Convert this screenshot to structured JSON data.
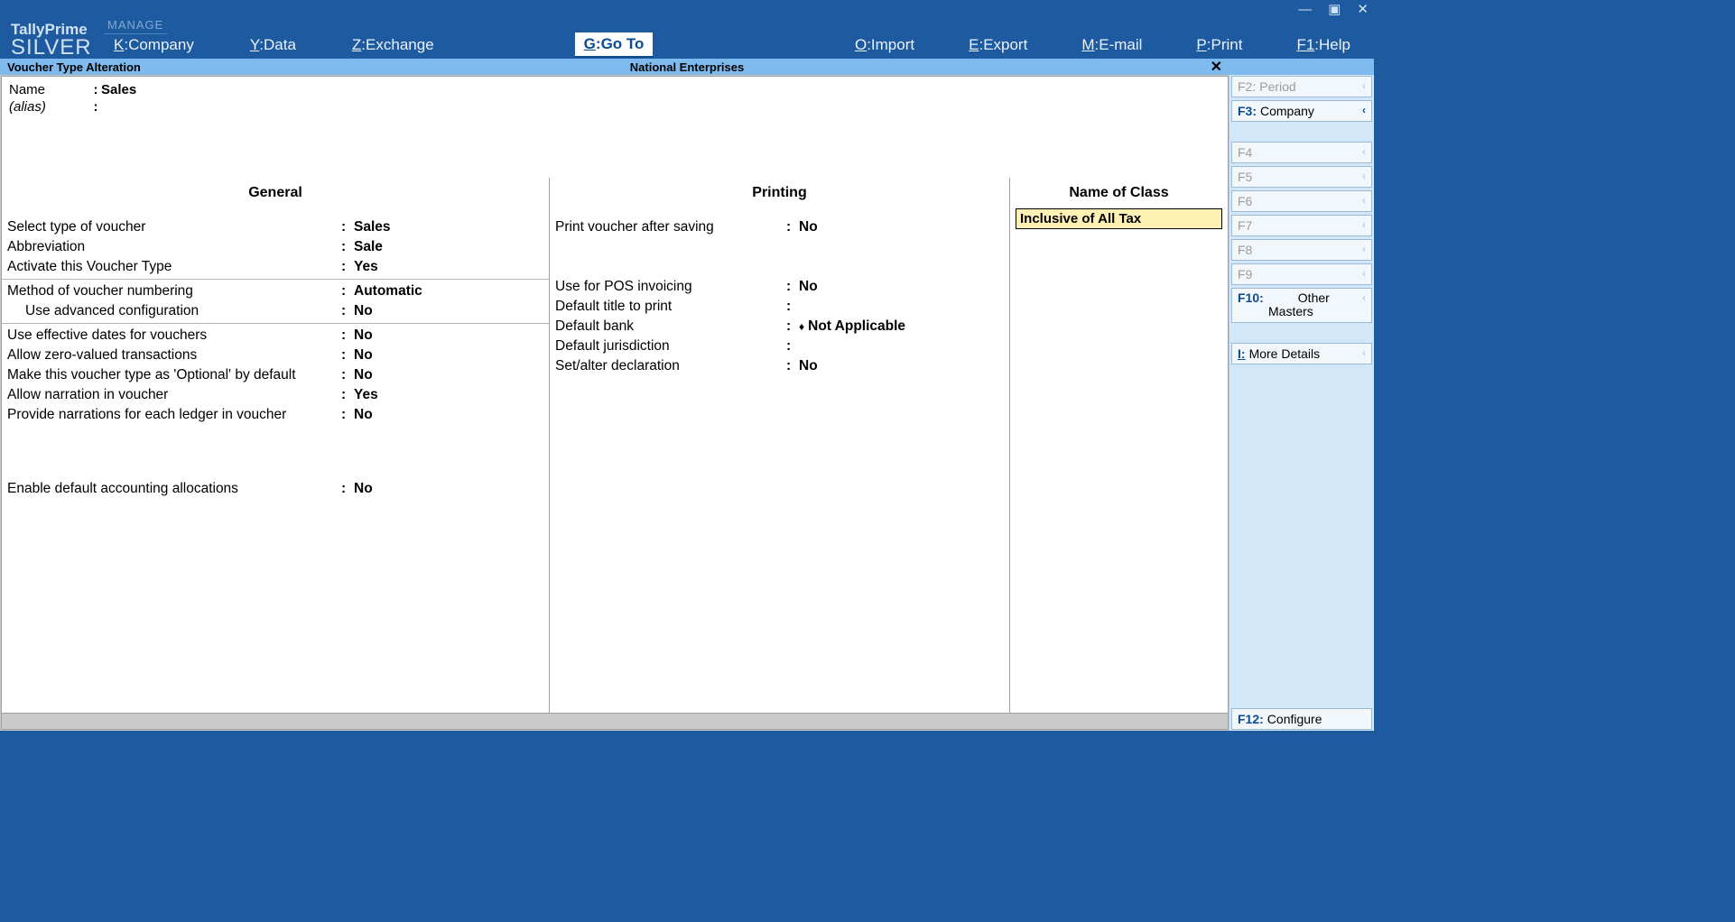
{
  "brand": {
    "line1": "TallyPrime",
    "line2": "SILVER"
  },
  "manage_label": "MANAGE",
  "menubar": {
    "company": {
      "key": "K",
      "label": "Company"
    },
    "data": {
      "key": "Y",
      "label": "Data"
    },
    "exchange": {
      "key": "Z",
      "label": "Exchange"
    },
    "goto": {
      "key": "G",
      "label": "Go To"
    },
    "import": {
      "key": "O",
      "label": "Import"
    },
    "export": {
      "key": "E",
      "label": "Export"
    },
    "email": {
      "key": "M",
      "label": "E-mail"
    },
    "print": {
      "key": "P",
      "label": "Print"
    },
    "help": {
      "key": "F1",
      "label": "Help"
    }
  },
  "subheader": {
    "title": "Voucher Type Alteration",
    "company": "National Enterprises"
  },
  "name_block": {
    "name_label": "Name",
    "name_value": "Sales",
    "alias_label": "(alias)"
  },
  "columns": {
    "general_header": "General",
    "printing_header": "Printing",
    "class_header": "Name of Class"
  },
  "general": {
    "select_type_label": "Select type of voucher",
    "select_type_value": "Sales",
    "abbrev_label": "Abbreviation",
    "abbrev_value": "Sale",
    "activate_label": "Activate this Voucher Type",
    "activate_value": "Yes",
    "numbering_label": "Method of voucher numbering",
    "numbering_value": "Automatic",
    "adv_config_label": "Use advanced configuration",
    "adv_config_value": "No",
    "eff_dates_label": "Use effective dates for vouchers",
    "eff_dates_value": "No",
    "zero_label": "Allow zero-valued transactions",
    "zero_value": "No",
    "optional_label": "Make this voucher type as 'Optional' by default",
    "optional_value": "No",
    "narration_label": "Allow narration in voucher",
    "narration_value": "Yes",
    "narr_each_label": "Provide narrations for each ledger in voucher",
    "narr_each_value": "No",
    "default_alloc_label": "Enable default accounting allocations",
    "default_alloc_value": "No"
  },
  "printing": {
    "after_save_label": "Print voucher after saving",
    "after_save_value": "No",
    "pos_label": "Use for POS invoicing",
    "pos_value": "No",
    "def_title_label": "Default title to print",
    "def_title_value": "",
    "def_bank_label": "Default bank",
    "def_bank_value": "Not Applicable",
    "def_juris_label": "Default jurisdiction",
    "def_juris_value": "",
    "decl_label": "Set/alter declaration",
    "decl_value": "No"
  },
  "class_entry": "Inclusive of All Tax",
  "side": {
    "f2": {
      "key": "F2:",
      "label": "Period"
    },
    "f3": {
      "key": "F3:",
      "label": "Company"
    },
    "f4": {
      "key": "F4",
      "label": ""
    },
    "f5": {
      "key": "F5",
      "label": ""
    },
    "f6": {
      "key": "F6",
      "label": ""
    },
    "f7": {
      "key": "F7",
      "label": ""
    },
    "f8": {
      "key": "F8",
      "label": ""
    },
    "f9": {
      "key": "F9",
      "label": ""
    },
    "f10": {
      "key": "F10:",
      "label1": "Other",
      "label2": "Masters"
    },
    "more": {
      "key": "I:",
      "label": "More Details"
    },
    "f12": {
      "key": "F12:",
      "label": "Configure"
    }
  }
}
